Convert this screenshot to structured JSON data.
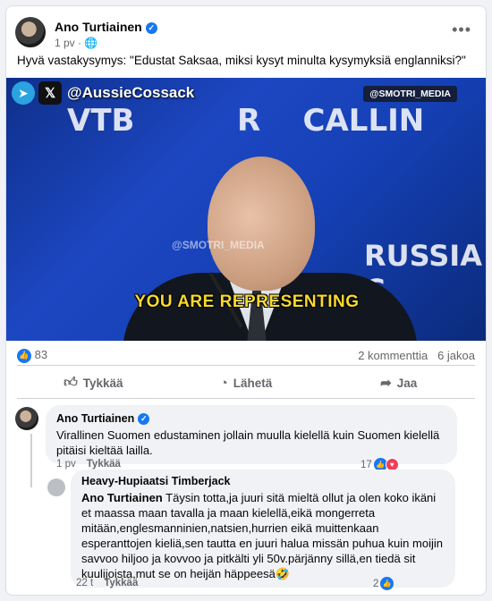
{
  "post": {
    "author": "Ano Turtiainen",
    "time": "1 pv",
    "privacy_icon": "globe-icon",
    "more_icon": "more-icon",
    "text": "Hyvä vastakysymys: \"Edustat Saksaa, miksi kysyt minulta kysymyksiä englanniksi?\""
  },
  "media": {
    "handle": "@AussieCossack",
    "watermark_tag": "@SMOTRI_MEDIA",
    "watermark_center": "@SMOTRI_MEDIA",
    "bg_text_vtb": "VTB",
    "bg_text_calling": "R    CALLIN",
    "bg_text_russia": "RUSSIA C",
    "caption": "YOU ARE REPRESENTING"
  },
  "stats": {
    "likes": "83",
    "comments": "2 kommenttia",
    "shares": "6 jakoa"
  },
  "actions": {
    "like": "Tykkää",
    "send": "Lähetä",
    "share": "Jaa"
  },
  "comments": [
    {
      "author": "Ano Turtiainen",
      "text": "Virallinen Suomen edustaminen jollain muulla kielellä kuin Suomen kielellä pitäisi kieltää lailla.",
      "time": "1 pv",
      "like_label": "Tykkää",
      "reaction_count": "17"
    },
    {
      "author": "Heavy-Hupiaatsi Timberjack",
      "mention": "Ano Turtiainen",
      "text": " Täysin totta,ja juuri sitä mieltä ollut ja olen koko ikäni et maassa maan tavalla ja maan kielellä,eikä mongerreta mitään,englesmanninien,natsien,hurrien eikä muittenkaan esperanttojen kieliä,sen tautta en juuri halua missän puhua kuin moijin savvoo hiljoo ja kovvoo ja pitkälti yli 50v.pärjänny sillä,en tiedä sit kuulijoista,mut se on heijän häppeesä🤣",
      "time": "22 t",
      "like_label": "Tykkää",
      "reaction_count": "2"
    }
  ]
}
